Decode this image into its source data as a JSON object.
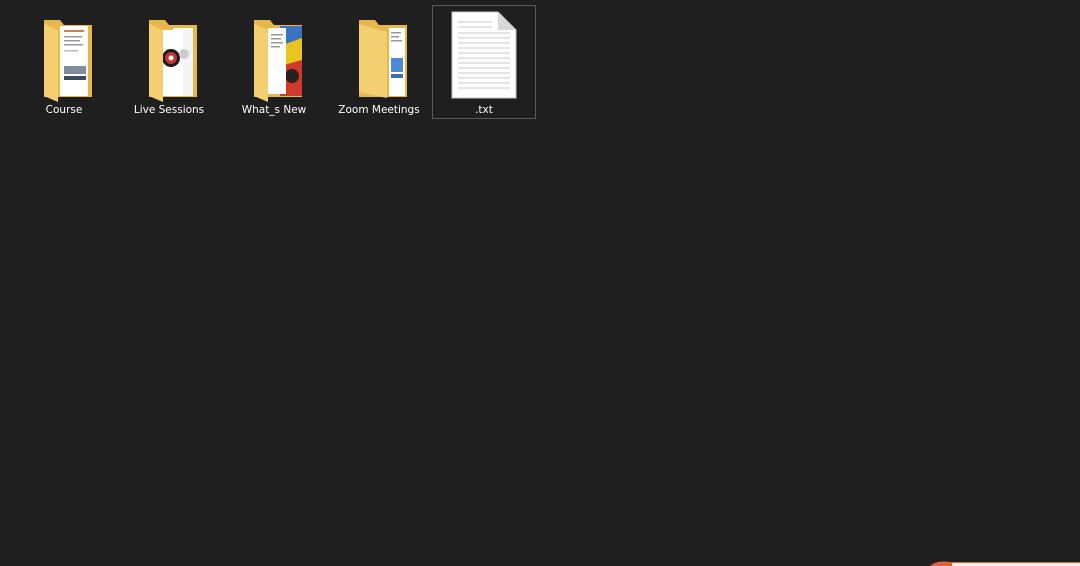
{
  "desktop": {
    "items": [
      {
        "label": "Course",
        "kind": "folder-preview-document",
        "icon": "folder-icon"
      },
      {
        "label": "Live Sessions",
        "kind": "folder-preview-disc",
        "icon": "folder-icon"
      },
      {
        "label": "What_s New",
        "kind": "folder-preview-colorful",
        "icon": "folder-icon"
      },
      {
        "label": "Zoom Meetings",
        "kind": "folder-preview-blue",
        "icon": "folder-icon"
      },
      {
        "label": ".txt",
        "kind": "text-file",
        "icon": "text-file-icon",
        "selected": true
      }
    ]
  },
  "colors": {
    "background": "#1f1f1f",
    "folder_front": "#f3cf72",
    "folder_back": "#e6b84a",
    "selection_border": "#5a5a5a",
    "label_text": "#ffffff"
  }
}
